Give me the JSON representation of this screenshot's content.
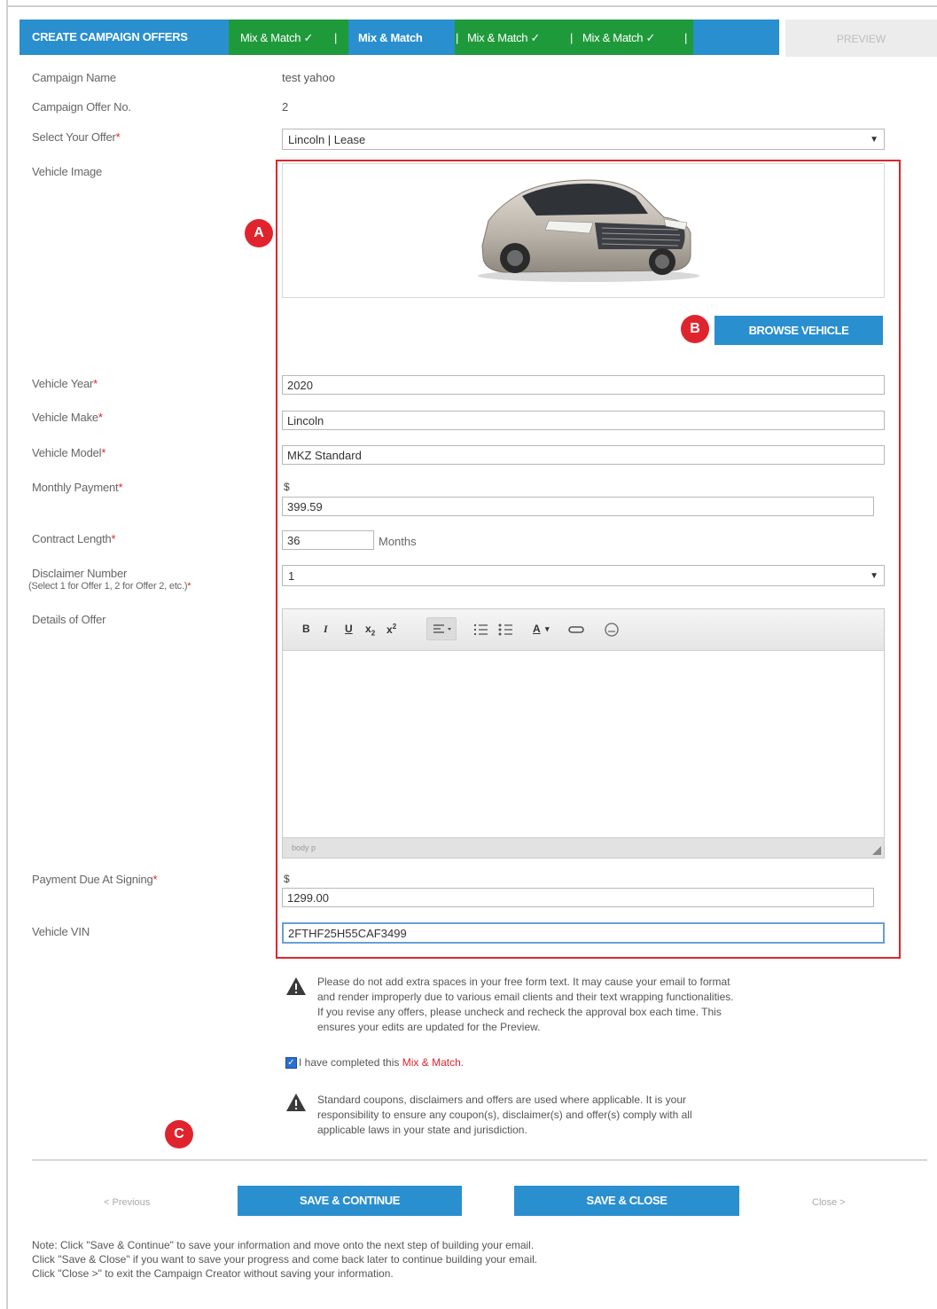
{
  "tabs": {
    "create": "CREATE CAMPAIGN OFFERS",
    "items": [
      "Mix & Match ✓",
      "Mix & Match",
      "Mix & Match ✓",
      "Mix & Match ✓"
    ],
    "preview": "PREVIEW"
  },
  "form": {
    "campaign_name_label": "Campaign Name",
    "campaign_name_value": "test yahoo",
    "offer_no_label": "Campaign Offer No.",
    "offer_no_value": "2",
    "select_offer_label": "Select Your Offer",
    "select_offer_value": "Lincoln | Lease",
    "vehicle_image_label": "Vehicle Image",
    "browse_button": "BROWSE VEHICLE",
    "year_label": "Vehicle Year",
    "year_value": "2020",
    "make_label": "Vehicle Make",
    "make_value": "Lincoln",
    "model_label": "Vehicle Model",
    "model_value": "MKZ Standard",
    "monthly_label": "Monthly Payment",
    "currency": "$",
    "monthly_value": "399.59",
    "contract_label": "Contract Length",
    "contract_value": "36",
    "contract_unit": "Months",
    "disclaimer_label": "Disclaimer Number",
    "disclaimer_sub": "(Select 1 for Offer 1, 2 for Offer 2, etc.)",
    "disclaimer_value": "1",
    "details_label": "Details of Offer",
    "editor_status": "body  p",
    "due_label": "Payment Due At Signing",
    "due_value": "1299.00",
    "vin_label": "Vehicle VIN",
    "vin_value": "2FTHF25H55CAF3499",
    "required_mark": "*"
  },
  "warnings": {
    "w1": [
      "Please do not add extra spaces in your free form text. It may cause your email to format",
      "and render improperly due to various email clients and their text wrapping functionalities.",
      "If you revise any offers, please uncheck and recheck the approval box each time. This",
      "ensures your edits are updated for the Preview."
    ],
    "checkbox_text": "I have completed this ",
    "checkbox_link": "Mix & Match.",
    "w2": [
      "Standard coupons, disclaimers and offers are used where applicable. It is your",
      "responsibility to ensure any coupon(s), disclaimer(s) and offer(s) comply with all",
      "applicable laws in your state and jurisdiction."
    ]
  },
  "nav": {
    "previous": "< Previous",
    "save_continue": "SAVE & CONTINUE",
    "save_close": "SAVE & CLOSE",
    "close": "Close >"
  },
  "notes": [
    "Note: Click \"Save & Continue\" to save your information and move onto the next step of building your email.",
    "Click \"Save & Close\" if you want to save your progress and come back later to continue building your email.",
    "Click \"Close >\" to exit the Campaign Creator without saving your information."
  ],
  "markers": {
    "a": "A",
    "b": "B",
    "c": "C"
  },
  "colors": {
    "accent_blue": "#2a8fce",
    "tab_green": "#1f9a3a",
    "required_red": "#e0242d"
  }
}
